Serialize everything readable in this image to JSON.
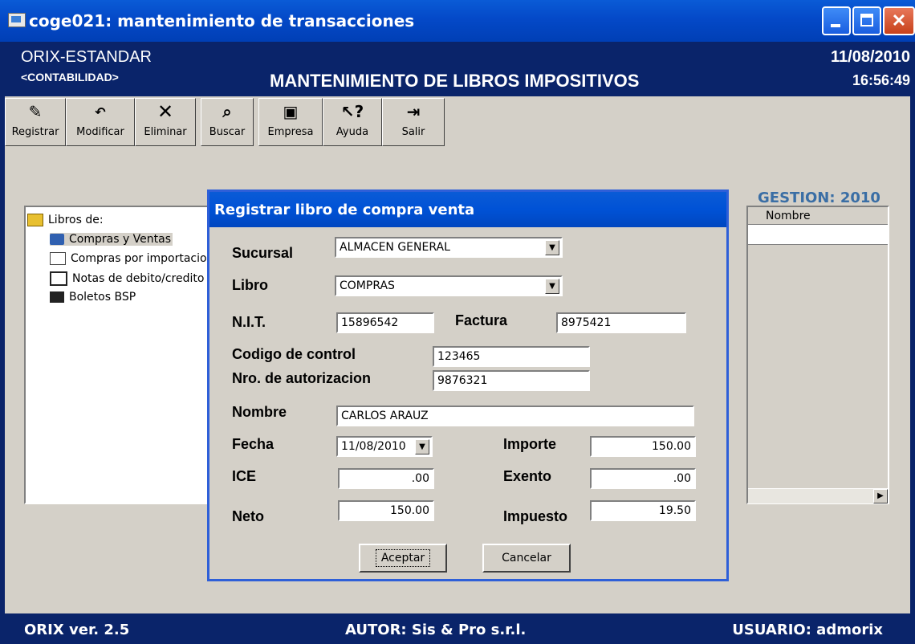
{
  "window": {
    "title": "coge021: mantenimiento de transacciones"
  },
  "header": {
    "app_name": "ORIX-ESTANDAR",
    "module": "<CONTABILIDAD>",
    "screen_title": "MANTENIMIENTO DE LIBROS IMPOSITIVOS",
    "date": "11/08/2010",
    "time": "16:56:49"
  },
  "toolbar": {
    "registrar": "Registrar",
    "modificar": "Modificar",
    "eliminar": "Eliminar",
    "buscar": "Buscar",
    "empresa": "Empresa",
    "ayuda": "Ayuda",
    "salir": "Salir"
  },
  "tree": {
    "root": "Libros de:",
    "items": [
      "Compras y Ventas",
      "Compras por importacio",
      "Notas de debito/credito",
      "Boletos BSP"
    ]
  },
  "right_panel": {
    "gestion": "GESTION: 2010",
    "column": "Nombre"
  },
  "dialog": {
    "title": "Registrar libro de compra venta",
    "sucursal_label": "Sucursal",
    "sucursal_value": "ALMACEN GENERAL",
    "libro_label": "Libro",
    "libro_value": "COMPRAS",
    "nit_label": "N.I.T.",
    "nit_value": "15896542",
    "factura_label": "Factura",
    "factura_value": "8975421",
    "codigo_label": "Codigo de control",
    "codigo_value": "123465",
    "autorizacion_label": "Nro. de autorizacion",
    "autorizacion_value": "9876321",
    "nombre_label": "Nombre",
    "nombre_value": "CARLOS ARAUZ",
    "fecha_label": "Fecha",
    "fecha_value": "11/08/2010",
    "importe_label": "Importe",
    "importe_value": "150.00",
    "ice_label": "ICE",
    "ice_value": ".00",
    "exento_label": "Exento",
    "exento_value": ".00",
    "neto_label": "Neto",
    "neto_value": "150.00",
    "impuesto_label": "Impuesto",
    "impuesto_value": "19.50",
    "aceptar": "Aceptar",
    "cancelar": "Cancelar"
  },
  "status": {
    "version": "ORIX ver. 2.5",
    "autor": "AUTOR: Sis & Pro s.r.l.",
    "usuario": "USUARIO: admorix"
  },
  "colors": {
    "title_blue": "#0a246a",
    "xp_title": "#0052d6",
    "face": "#d4d0c8",
    "gestion": "#3a6ea5"
  }
}
